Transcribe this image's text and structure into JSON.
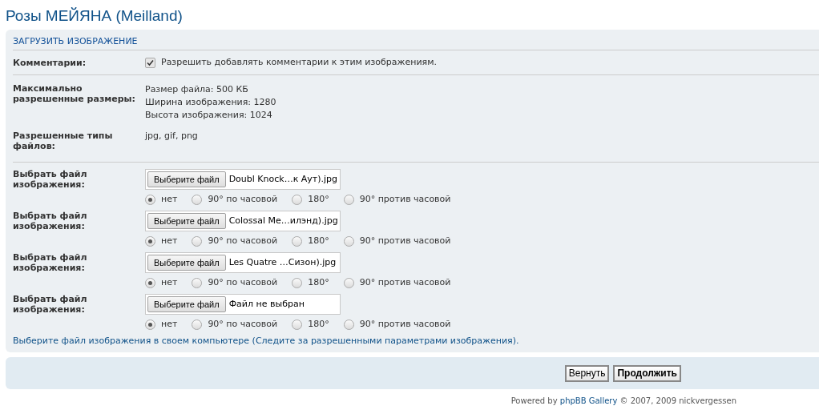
{
  "page_title": "Розы МЕЙЯНА (Meilland)",
  "panel": {
    "heading": "ЗАГРУЗИТЬ ИЗОБРАЖЕНИЕ",
    "comments": {
      "label": "Комментарии:",
      "checked": true,
      "text": "Разрешить добавлять комментарии к этим изображениям."
    },
    "limits": {
      "label": "Максимально разрешенные размеры:",
      "lines": [
        "Размер файла: 500 КБ",
        "Ширина изображения: 1280",
        "Высота изображения: 1024"
      ]
    },
    "types": {
      "label": "Разрешенные типы файлов:",
      "value": "jpg, gif, png"
    },
    "files": [
      {
        "label": "Выбрать файл изображения:",
        "button": "Выберите файл",
        "file_name": "Doubl Knock…к Аут).jpg",
        "rotations": [
          {
            "label": "нет",
            "selected": true
          },
          {
            "label": "90° по часовой",
            "selected": false
          },
          {
            "label": "180°",
            "selected": false
          },
          {
            "label": "90° против часовой",
            "selected": false
          }
        ]
      },
      {
        "label": "Выбрать файл изображения:",
        "button": "Выберите файл",
        "file_name": "Colossal Me…илэнд).jpg",
        "rotations": [
          {
            "label": "нет",
            "selected": true
          },
          {
            "label": "90° по часовой",
            "selected": false
          },
          {
            "label": "180°",
            "selected": false
          },
          {
            "label": "90° против часовой",
            "selected": false
          }
        ]
      },
      {
        "label": "Выбрать файл изображения:",
        "button": "Выберите файл",
        "file_name": "Les Quatre …Сизон).jpg",
        "rotations": [
          {
            "label": "нет",
            "selected": true
          },
          {
            "label": "90° по часовой",
            "selected": false
          },
          {
            "label": "180°",
            "selected": false
          },
          {
            "label": "90° против часовой",
            "selected": false
          }
        ]
      },
      {
        "label": "Выбрать файл изображения:",
        "button": "Выберите файл",
        "file_name": "Файл не выбран",
        "rotations": [
          {
            "label": "нет",
            "selected": true
          },
          {
            "label": "90° по часовой",
            "selected": false
          },
          {
            "label": "180°",
            "selected": false
          },
          {
            "label": "90° против часовой",
            "selected": false
          }
        ]
      }
    ],
    "hint": "Выберите файл изображения в своем компьютере (Следите за разрешенными параметрами изображения)."
  },
  "buttons": [
    {
      "label": "Вернуть",
      "primary": false
    },
    {
      "label": "Продолжить",
      "primary": true
    }
  ],
  "footer": {
    "before": "Powered by ",
    "link": "phpBB Gallery",
    "after": " © 2007, 2009 nickvergessen"
  }
}
